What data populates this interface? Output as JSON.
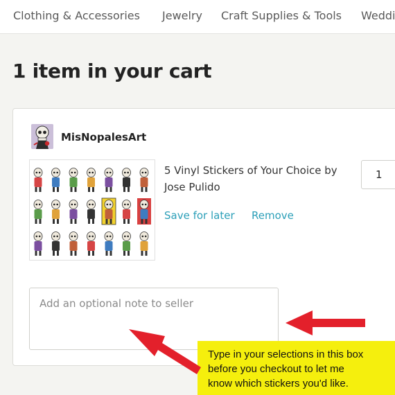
{
  "nav": {
    "items": [
      "Clothing & Accessories",
      "Jewelry",
      "Craft Supplies & Tools",
      "Weddi"
    ]
  },
  "cart": {
    "title": "1 item in your cart"
  },
  "shop": {
    "name": "MisNopalesArt"
  },
  "item": {
    "title": "5 Vinyl Stickers of Your Choice by Jose Pulido",
    "save_label": "Save for later",
    "remove_label": "Remove",
    "quantity": "1"
  },
  "note": {
    "placeholder": "Add an optional note to seller"
  },
  "annotation": {
    "lines": [
      "Type in your selections in this box",
      "before you checkout to let me",
      "know which stickers you'd like."
    ]
  },
  "colors": {
    "link": "#2b9fb8",
    "callout_bg": "#f5ef0d",
    "arrow": "#e3202b"
  }
}
